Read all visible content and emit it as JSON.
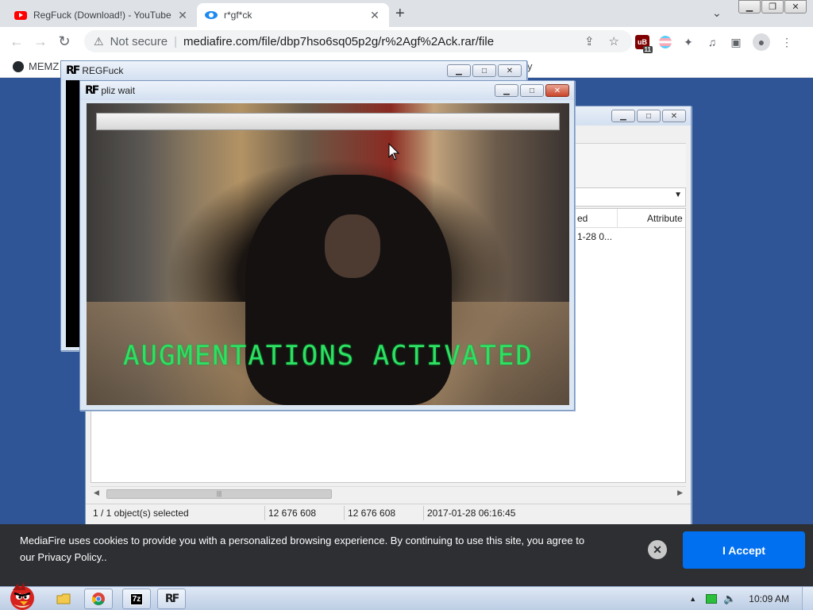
{
  "browser": {
    "tabs": [
      {
        "title": "RegFuck (Download!) - YouTube",
        "favicon": "youtube-icon",
        "active": false
      },
      {
        "title": "r*gf*ck",
        "favicon": "mediafire-icon",
        "active": true
      }
    ],
    "new_tab_label": "+",
    "address": {
      "security_label": "Not secure",
      "url": "mediafire.com/file/dbp7hso6sq05p2g/r%2Agf%2Ack.rar/file"
    },
    "extension_badge": "11",
    "bookmarks": [
      {
        "label": "MEMZ",
        "icon": "github-icon"
      }
    ],
    "bookmark_trailing": "y"
  },
  "windows": {
    "regfuck": {
      "title": "REGFuck"
    },
    "wait": {
      "title": "pliz wait",
      "overlay_text": "AUGMENTATIONS ACTIVATED",
      "progress": 0
    },
    "explorer": {
      "columns": [
        "ed",
        "Attribute"
      ],
      "row_text": "1-28 0...",
      "status": {
        "selection": "1 / 1 object(s) selected",
        "size": "12 676 608",
        "packed": "12 676 608",
        "modified": "2017-01-28 06:16:45"
      },
      "scroll_grip": "|||"
    }
  },
  "cookie_banner": {
    "text": "MediaFire uses cookies to provide you with a personalized browsing experience. By continuing to use this site, you agree to our Privacy Policy..",
    "accept_label": "I Accept",
    "close_label": "✕"
  },
  "taskbar": {
    "apps": [
      {
        "name": "explorer-icon",
        "label": ""
      },
      {
        "name": "chrome-icon",
        "label": ""
      },
      {
        "name": "7zip-icon",
        "label": "7z"
      },
      {
        "name": "regfuck-icon",
        "label": "RF"
      }
    ],
    "clock": "10:09 AM"
  },
  "colors": {
    "page_bg": "#2f5597",
    "cookie_bg": "#2d2f33",
    "accept_bg": "#0070f0",
    "overlay_green": "#2ee063"
  }
}
